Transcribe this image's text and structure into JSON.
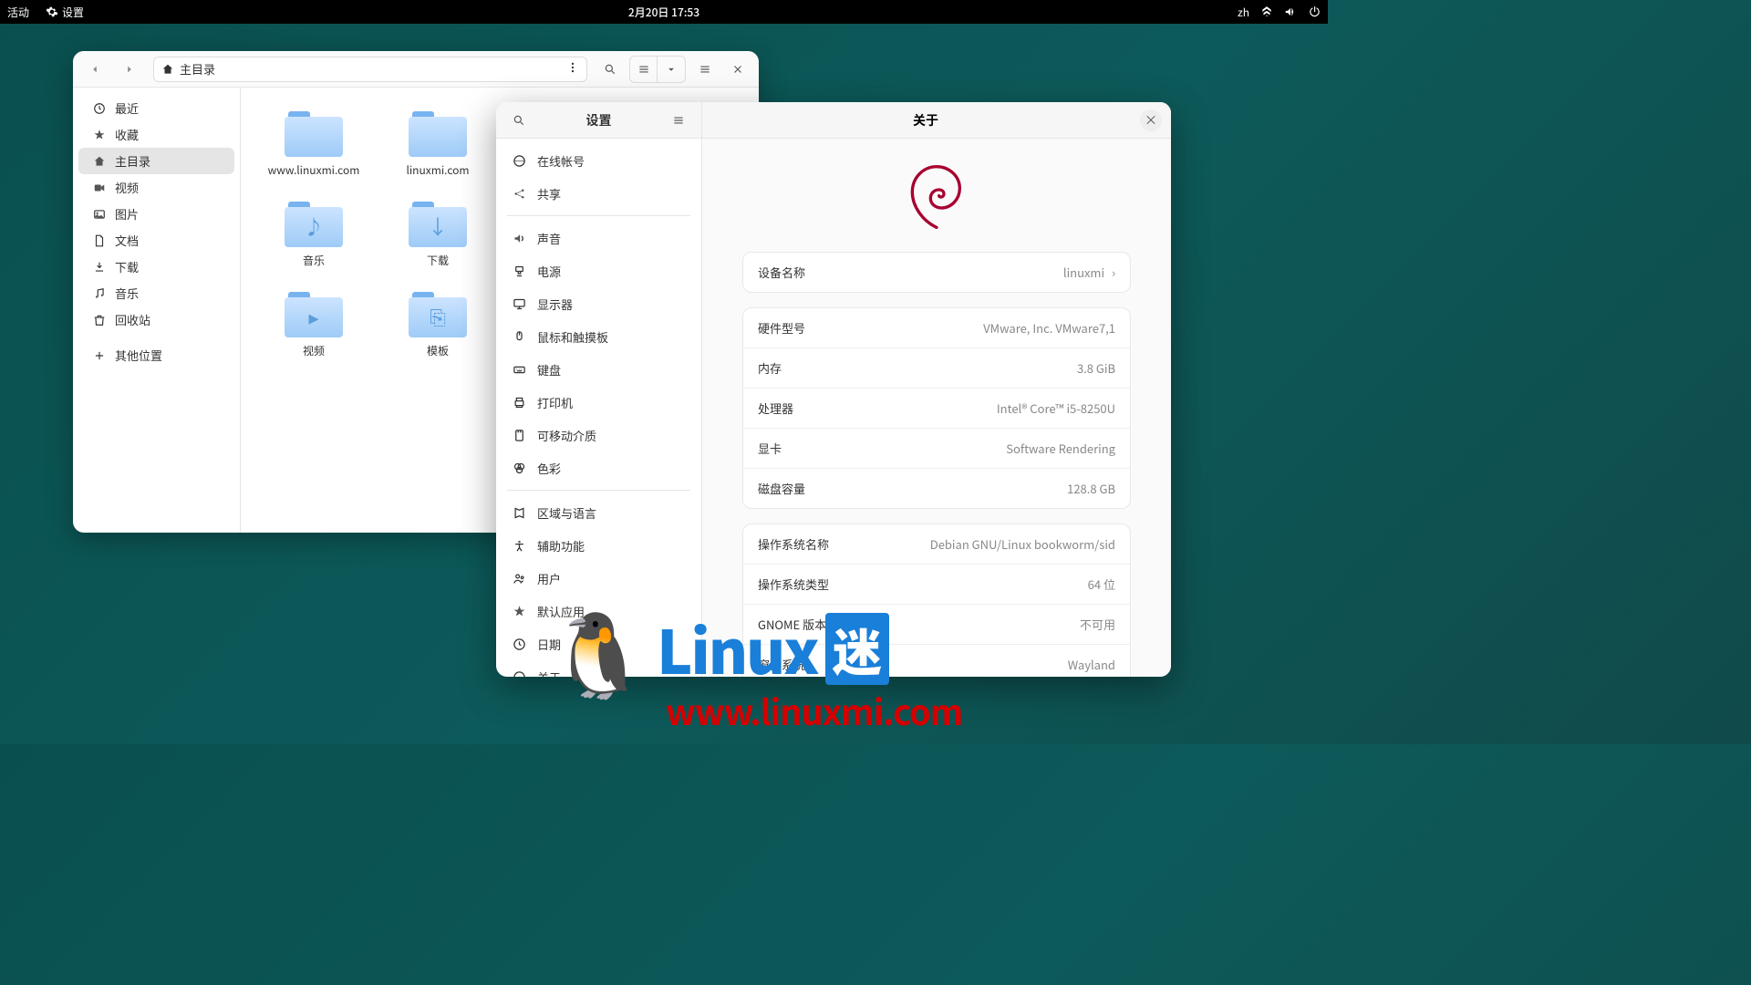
{
  "topbar": {
    "activities": "活动",
    "app": "设置",
    "datetime": "2月20日  17:53",
    "lang": "zh"
  },
  "files": {
    "path_label": "主目录",
    "sidebar": [
      {
        "icon": "clock",
        "label": "最近"
      },
      {
        "icon": "star",
        "label": "收藏"
      },
      {
        "icon": "home",
        "label": "主目录",
        "active": true
      },
      {
        "icon": "video",
        "label": "视频"
      },
      {
        "icon": "image",
        "label": "图片"
      },
      {
        "icon": "doc",
        "label": "文档"
      },
      {
        "icon": "download",
        "label": "下载"
      },
      {
        "icon": "music",
        "label": "音乐"
      },
      {
        "icon": "trash",
        "label": "回收站"
      },
      {
        "icon": "plus",
        "label": "其他位置",
        "sep": true
      }
    ],
    "items": [
      {
        "glyph": "",
        "label": "www.linuxmi.com"
      },
      {
        "glyph": "",
        "label": "linuxmi.com"
      },
      {
        "glyph": "♪",
        "label": "音乐"
      },
      {
        "glyph": "↓",
        "label": "下载"
      },
      {
        "glyph": "▸",
        "label": "视频"
      },
      {
        "glyph": "⎘",
        "label": "模板"
      }
    ]
  },
  "settings": {
    "sidebar_title": "设置",
    "main_title": "关于",
    "nav": [
      {
        "icon": "online",
        "label": "在线帐号"
      },
      {
        "icon": "share",
        "label": "共享"
      },
      {
        "divider": true
      },
      {
        "icon": "sound",
        "label": "声音"
      },
      {
        "icon": "power",
        "label": "电源"
      },
      {
        "icon": "display",
        "label": "显示器"
      },
      {
        "icon": "mouse",
        "label": "鼠标和触摸板"
      },
      {
        "icon": "keyboard",
        "label": "键盘"
      },
      {
        "icon": "printer",
        "label": "打印机"
      },
      {
        "icon": "removable",
        "label": "可移动介质"
      },
      {
        "icon": "color",
        "label": "色彩"
      },
      {
        "divider": true
      },
      {
        "icon": "region",
        "label": "区域与语言"
      },
      {
        "icon": "a11y",
        "label": "辅助功能"
      },
      {
        "icon": "users",
        "label": "用户"
      },
      {
        "icon": "defaultapp",
        "label": "默认应用"
      },
      {
        "icon": "datetime",
        "label": "日期"
      },
      {
        "icon": "about",
        "label": "关于"
      }
    ],
    "device_name": {
      "label": "设备名称",
      "value": "linuxmi"
    },
    "specs": [
      {
        "label": "硬件型号",
        "value": "VMware, Inc. VMware7,1"
      },
      {
        "label": "内存",
        "value": "3.8 GiB"
      },
      {
        "label": "处理器",
        "value": "Intel® Core™ i5-8250U"
      },
      {
        "label": "显卡",
        "value": "Software Rendering"
      },
      {
        "label": "磁盘容量",
        "value": "128.8 GB"
      }
    ],
    "os": [
      {
        "label": "操作系统名称",
        "value": "Debian GNU/Linux bookworm/sid"
      },
      {
        "label": "操作系统类型",
        "value": "64 位"
      },
      {
        "label": "GNOME 版本",
        "value": "不可用"
      },
      {
        "label": "窗口系统",
        "value": "Wayland"
      }
    ]
  },
  "watermark": {
    "brand": "Linux",
    "suffix": "迷",
    "url": "www.linuxmi.com"
  }
}
